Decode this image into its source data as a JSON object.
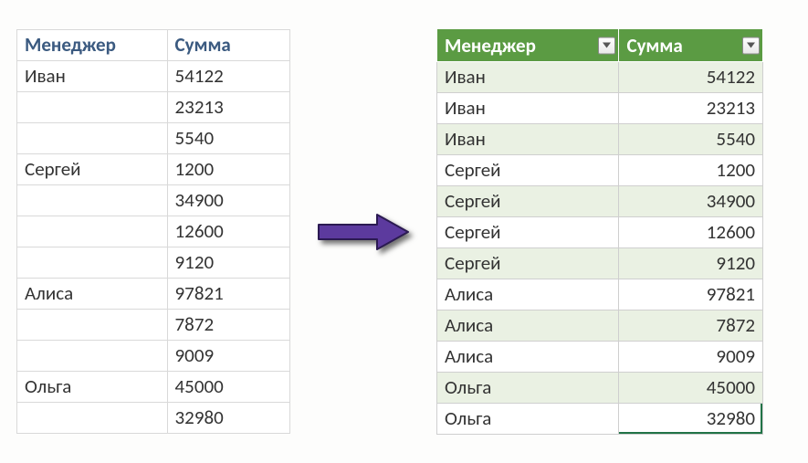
{
  "left": {
    "headers": {
      "manager": "Менеджер",
      "amount": "Сумма"
    },
    "rows": [
      {
        "manager": "Иван",
        "amount": "54122"
      },
      {
        "manager": "",
        "amount": "23213"
      },
      {
        "manager": "",
        "amount": "5540"
      },
      {
        "manager": "Сергей",
        "amount": "1200"
      },
      {
        "manager": "",
        "amount": "34900"
      },
      {
        "manager": "",
        "amount": "12600"
      },
      {
        "manager": "",
        "amount": "9120"
      },
      {
        "manager": "Алиса",
        "amount": "97821"
      },
      {
        "manager": "",
        "amount": "7872"
      },
      {
        "manager": "",
        "amount": "9009"
      },
      {
        "manager": "Ольга",
        "amount": "45000"
      },
      {
        "manager": "",
        "amount": "32980"
      }
    ]
  },
  "right": {
    "headers": {
      "manager": "Менеджер",
      "amount": "Сумма"
    },
    "rows": [
      {
        "manager": "Иван",
        "amount": "54122"
      },
      {
        "manager": "Иван",
        "amount": "23213"
      },
      {
        "manager": "Иван",
        "amount": "5540"
      },
      {
        "manager": "Сергей",
        "amount": "1200"
      },
      {
        "manager": "Сергей",
        "amount": "34900"
      },
      {
        "manager": "Сергей",
        "amount": "12600"
      },
      {
        "manager": "Сергей",
        "amount": "9120"
      },
      {
        "manager": "Алиса",
        "amount": "97821"
      },
      {
        "manager": "Алиса",
        "amount": "7872"
      },
      {
        "manager": "Алиса",
        "amount": "9009"
      },
      {
        "manager": "Ольга",
        "amount": "45000"
      },
      {
        "manager": "Ольга",
        "amount": "32980"
      }
    ]
  },
  "colors": {
    "table_header_green": "#5b9b43",
    "band_light_green": "#eaf1e3",
    "left_header_text": "#3b5a80",
    "arrow_fill": "#5c3a9e",
    "arrow_stroke": "#2b1a52"
  }
}
